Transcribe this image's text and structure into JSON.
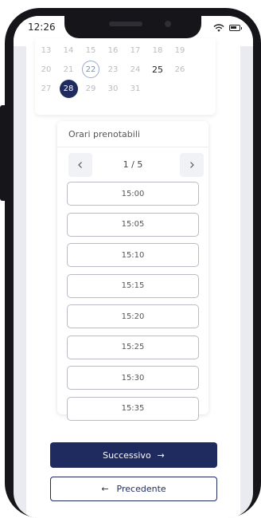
{
  "status_bar": {
    "time": "12:26",
    "wifi_icon": "wifi-icon",
    "battery_icon": "battery-icon"
  },
  "calendar": {
    "rows": [
      [
        {
          "label": "13",
          "state": "disabled"
        },
        {
          "label": "14",
          "state": "disabled"
        },
        {
          "label": "15",
          "state": "disabled"
        },
        {
          "label": "16",
          "state": "disabled"
        },
        {
          "label": "17",
          "state": "disabled"
        },
        {
          "label": "18",
          "state": "disabled"
        },
        {
          "label": "19",
          "state": "disabled"
        }
      ],
      [
        {
          "label": "20",
          "state": "disabled"
        },
        {
          "label": "21",
          "state": "disabled"
        },
        {
          "label": "22",
          "state": "today"
        },
        {
          "label": "23",
          "state": "disabled"
        },
        {
          "label": "24",
          "state": "disabled"
        },
        {
          "label": "25",
          "state": "available"
        },
        {
          "label": "26",
          "state": "disabled"
        }
      ],
      [
        {
          "label": "27",
          "state": "disabled"
        },
        {
          "label": "28",
          "state": "selected"
        },
        {
          "label": "29",
          "state": "disabled"
        },
        {
          "label": "30",
          "state": "disabled"
        },
        {
          "label": "31",
          "state": "disabled"
        }
      ]
    ]
  },
  "slots": {
    "title": "Orari prenotabili",
    "pager_label": "1 / 5",
    "prev_icon": "chevron-left-icon",
    "next_icon": "chevron-right-icon",
    "times": [
      "15:00",
      "15:05",
      "15:10",
      "15:15",
      "15:20",
      "15:25",
      "15:30",
      "15:35"
    ]
  },
  "actions": {
    "next_label": "Successivo",
    "next_arrow": "→",
    "prev_label": "Precedente",
    "prev_arrow": "←"
  },
  "colors": {
    "primary": "#1f2b5e",
    "background": "#e9ebf1"
  }
}
